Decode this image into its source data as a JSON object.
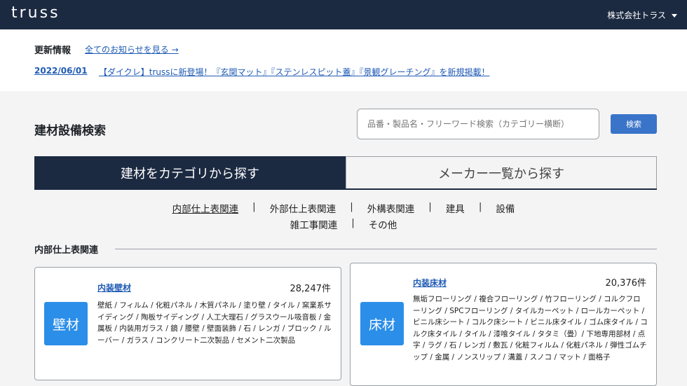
{
  "header": {
    "logo": "truss",
    "company": "株式会社トラス"
  },
  "news": {
    "title": "更新情報",
    "all_link": "全てのお知らせを見る →",
    "date": "2022/06/01",
    "text": "【ダイクレ】trussに新登場！『玄関マット』『ステンレスピット蓋』『景観グレーチング』を新規掲載！"
  },
  "search": {
    "heading": "建材設備検索",
    "placeholder": "品番・製品名・フリーワード検索（カテゴリー横断）",
    "button": "検索"
  },
  "tabs": {
    "category": "建材をカテゴリから探す",
    "maker": "メーカー一覧から探す"
  },
  "categories": {
    "row1": [
      "内部仕上表関連",
      "外部仕上表関連",
      "外構表関連",
      "建具",
      "設備"
    ],
    "row2": [
      "雑工事関連",
      "その他"
    ],
    "separator": "|"
  },
  "section": {
    "title": "内部仕上表関連"
  },
  "cards": [
    {
      "badge": "壁材",
      "name": "内装壁材",
      "count": "28,247件",
      "desc": "壁紙 / フィルム / 化粧パネル / 木質パネル / 塗り壁 / タイル / 窯業系サイディング / 陶板サイディング / 人工大理石 / グラスウール吸音板 / 金属板 / 内装用ガラス / 鏡 / 腰壁 / 壁面装飾 / 石 / レンガ / ブロック / ルーバー / ガラス / コンクリート二次製品 / セメント二次製品"
    },
    {
      "badge": "床材",
      "name": "内装床材",
      "count": "20,376件",
      "desc": "無垢フローリング / 複合フローリング / 竹フローリング / コルクフローリング / SPCフローリング / タイルカーペット / ロールカーペット / ビニル床シート / コルク床シート / ビニル床タイル / ゴム床タイル / コルク床タイル / タイル / 漆喰タイル / タタミ（畳）/ 下地専用部材 / 点字 / ラグ / 石 / レンガ / 敷瓦 / 化粧フィルム / 化粧パネル / 弾性ゴムチップ / 金属 / ノンスリップ / 溝蓋 / スノコ / マット / 面格子"
    }
  ]
}
